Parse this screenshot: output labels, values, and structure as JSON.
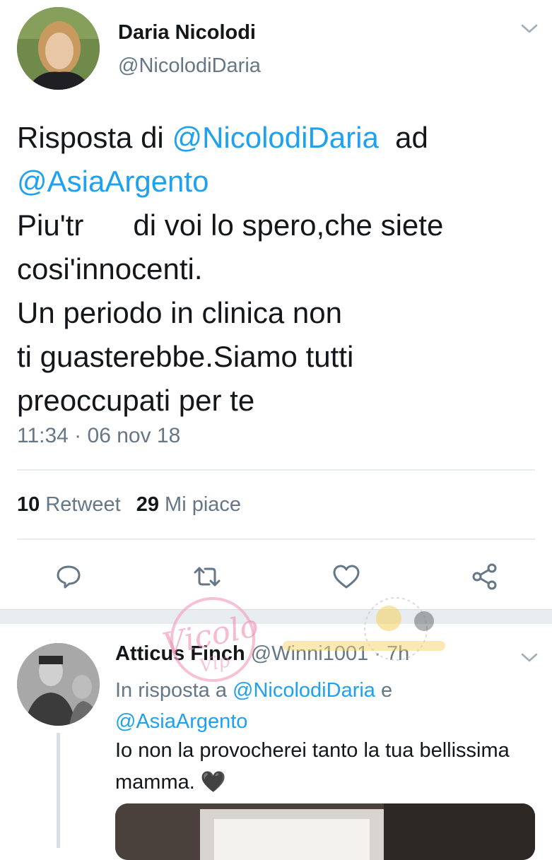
{
  "main_tweet": {
    "author_name": "Daria Nicolodi",
    "author_handle": "@NicolodiDaria",
    "reply_prefix": "Risposta di ",
    "mention_author": "@NicolodiDaria",
    "reply_connector": "  ad",
    "mention_target": "@AsiaArgento",
    "text_lines": [
      "Piu'tr      di voi lo spero,che siete",
      "cosi'innocenti.",
      "Un periodo in clinica non",
      "ti guasterebbe.Siamo tutti",
      "preoccupati per te"
    ],
    "timestamp": "11:34 · 06 nov 18",
    "retweet_count": "10",
    "retweet_label": "Retweet",
    "like_count": "29",
    "like_label": "Mi piace",
    "icons": {
      "reply": "reply-icon",
      "retweet": "retweet-icon",
      "like": "heart-icon",
      "share": "share-icon",
      "menu": "chevron-down-icon"
    }
  },
  "reply_tweet": {
    "author_name": "Atticus Finch",
    "author_handle": "@Winni1001",
    "time": " · 7h",
    "reply_label": "In risposta a ",
    "mention_1": "@NicolodiDaria",
    "conjunction": " e",
    "mention_2": "@AsiaArgento",
    "text": "Io non la provocherei tanto la tua bellissima mamma. 🖤"
  },
  "watermark": {
    "text": "Vicolo delle Vip"
  },
  "colors": {
    "link": "#1da1f2",
    "secondary_text": "#657786",
    "primary_text": "#14171a",
    "divider": "#e6ecf0"
  }
}
